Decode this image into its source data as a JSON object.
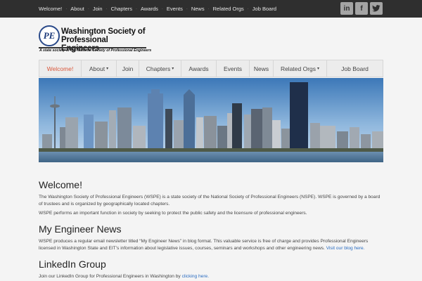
{
  "topnav": {
    "items": [
      "Welcome!",
      "About",
      "Join",
      "Chapters",
      "Awards",
      "Events",
      "News",
      "Related Orgs",
      "Job Board"
    ]
  },
  "social": {
    "linkedin": "in",
    "facebook": "f",
    "twitter_icon": "twitter-bird"
  },
  "logo": {
    "mark": "PE",
    "name_line1": "Washington Society of",
    "name_line2": "Professional Engineers",
    "tagline": "A state society of the National Society of Professional Engineers"
  },
  "mainnav": {
    "items": [
      {
        "label": "Welcome!",
        "active": true,
        "dropdown": false
      },
      {
        "label": "About",
        "active": false,
        "dropdown": true
      },
      {
        "label": "Join",
        "active": false,
        "dropdown": false
      },
      {
        "label": "Chapters",
        "active": false,
        "dropdown": true
      },
      {
        "label": "Awards",
        "active": false,
        "dropdown": false
      },
      {
        "label": "Events",
        "active": false,
        "dropdown": false
      },
      {
        "label": "News",
        "active": false,
        "dropdown": false
      },
      {
        "label": "Related Orgs",
        "active": false,
        "dropdown": true
      },
      {
        "label": "Job Board",
        "active": false,
        "dropdown": false
      }
    ],
    "caret": "▾"
  },
  "sections": {
    "welcome": {
      "heading": "Welcome!",
      "p1": "The Washington Society of Professional Engineers (WSPE) is a state society of the National Society of Professional Engineers (NSPE). WSPE is governed by a board of trustees and is organized by geographically located chapters.",
      "p2": "WSPE performs an important function in society by seeking to protect the public safety and the licensure of professional engineers."
    },
    "news": {
      "heading": "My Engineer News",
      "text": "WSPE produces a regular email newsletter titled “My Engineer News” in blog format.  This valuable service is free of charge and provides Professional Engineers licensed in Washington State and EIT’s information about legislative issues, courses, seminars and workshops and other engineering news.",
      "link": "Visit our blog here."
    },
    "linkedin": {
      "heading": "LinkedIn Group",
      "text": "Join our LinkedIn Group for Professional Engineers in Washington by",
      "link": "clicking here."
    }
  },
  "colors": {
    "topbar": "#2f2f2f",
    "active_nav": "#d9573a",
    "link": "#2a6cc0",
    "logo_blue": "#1c3a7a"
  }
}
